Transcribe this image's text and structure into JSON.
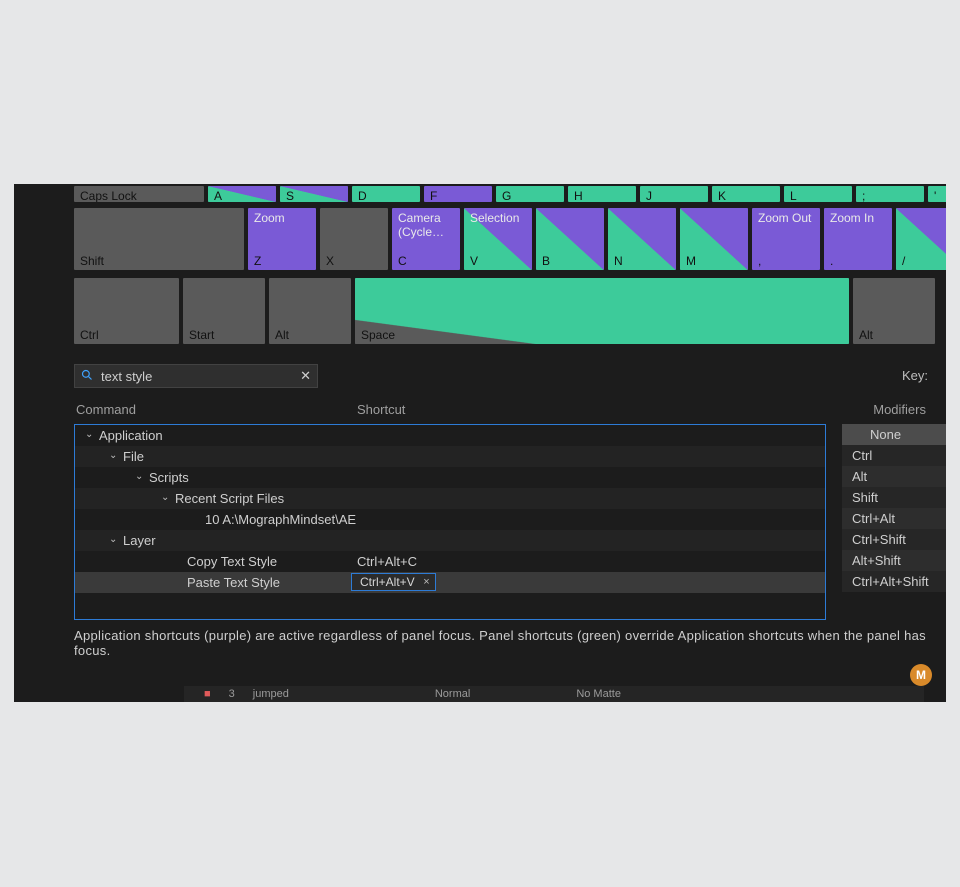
{
  "keyboard": {
    "caps_row": [
      {
        "label": "Caps Lock",
        "cls": "w-caps",
        "style": "grey"
      },
      {
        "label": "A",
        "style": "split"
      },
      {
        "label": "S",
        "style": "split"
      },
      {
        "label": "D",
        "style": "green"
      },
      {
        "label": "F",
        "style": "purple"
      },
      {
        "label": "G",
        "style": "green"
      },
      {
        "label": "H",
        "style": "green"
      },
      {
        "label": "J",
        "style": "green"
      },
      {
        "label": "K",
        "style": "green"
      },
      {
        "label": "L",
        "style": "green"
      },
      {
        "label": ";",
        "style": "green"
      },
      {
        "label": "'",
        "style": "green"
      }
    ],
    "shift_row": [
      {
        "label": "Shift",
        "cls": "w-shift",
        "style": "grey"
      },
      {
        "label": "Z",
        "top": "Zoom",
        "style": "purple"
      },
      {
        "label": "X",
        "style": "grey"
      },
      {
        "label": "C",
        "top": "Camera (Cycle…",
        "style": "purple"
      },
      {
        "label": "V",
        "top": "Selection",
        "style": "split"
      },
      {
        "label": "B",
        "style": "split"
      },
      {
        "label": "N",
        "style": "split"
      },
      {
        "label": "M",
        "style": "split"
      },
      {
        "label": ",",
        "top": "Zoom Out",
        "style": "purple"
      },
      {
        "label": ".",
        "top": "Zoom In",
        "style": "purple"
      },
      {
        "label": "/",
        "style": "split"
      }
    ],
    "ctrl_row": [
      {
        "label": "Ctrl",
        "cls": "w-ctrl",
        "style": "grey"
      },
      {
        "label": "Start",
        "cls": "w-start",
        "style": "grey"
      },
      {
        "label": "Alt",
        "cls": "w-alt",
        "style": "grey"
      },
      {
        "label": "Space",
        "cls": "w-space",
        "style": "space"
      },
      {
        "label": "Alt",
        "cls": "w-altR",
        "style": "grey"
      }
    ]
  },
  "search": {
    "value": "text style"
  },
  "key_label": "Key:",
  "headers": {
    "command": "Command",
    "shortcut": "Shortcut",
    "modifiers": "Modifiers"
  },
  "tree": [
    {
      "depth": 1,
      "chev": true,
      "label": "Application"
    },
    {
      "depth": 2,
      "chev": true,
      "label": "File",
      "alt": true
    },
    {
      "depth": 3,
      "chev": true,
      "label": "Scripts"
    },
    {
      "depth": 4,
      "chev": true,
      "label": "Recent Script Files",
      "alt": true
    },
    {
      "depth": 6,
      "chev": false,
      "label": "10 A:\\MographMindset\\AE"
    },
    {
      "depth": 2,
      "chev": true,
      "label": "Layer",
      "alt": true
    },
    {
      "depth": 5,
      "chev": false,
      "label": "Copy Text Style",
      "shortcut": "Ctrl+Alt+C"
    },
    {
      "depth": 5,
      "chev": false,
      "label": "Paste Text Style",
      "shortcut_box": "Ctrl+Alt+V",
      "sel": true,
      "alt": true
    }
  ],
  "modifiers": [
    "None",
    "Ctrl",
    "Alt",
    "Shift",
    "Ctrl+Alt",
    "Ctrl+Shift",
    "Alt+Shift",
    "Ctrl+Alt+Shift"
  ],
  "modifiers_selected_index": 0,
  "footer": "Application shortcuts (purple) are active regardless of panel focus. Panel shortcuts (green) override Application shortcuts when the panel has focus.",
  "badge": "M",
  "ghost": {
    "num": "3",
    "mode": "jumped",
    "blend": "Normal",
    "matte": "No Matte"
  }
}
